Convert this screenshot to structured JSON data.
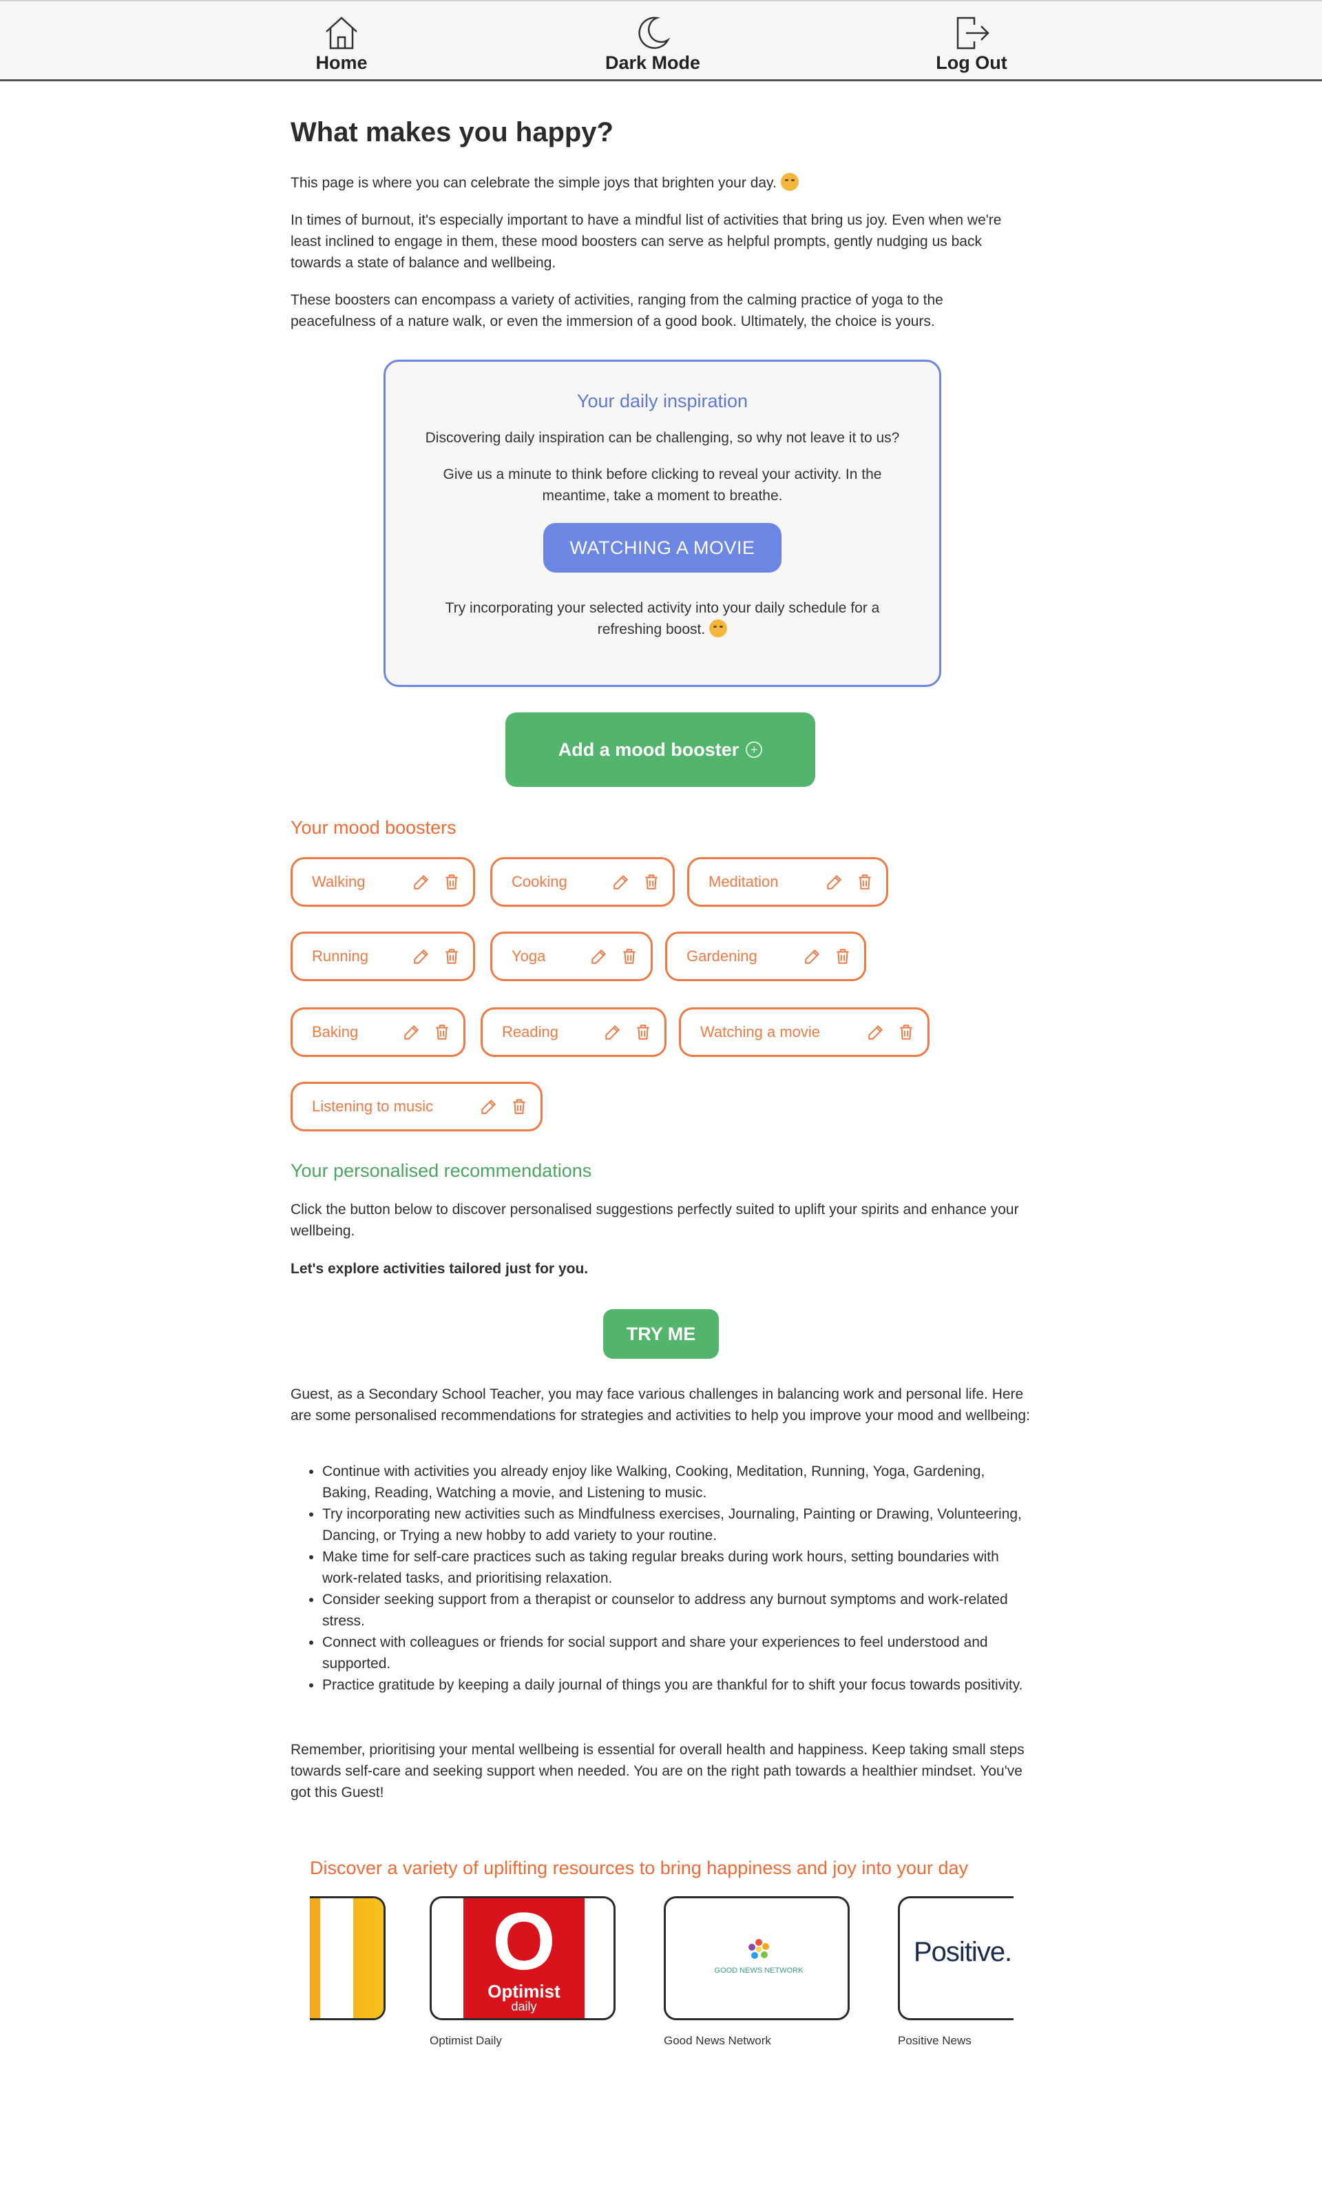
{
  "nav": {
    "home": "Home",
    "dark_mode": "Dark Mode",
    "log_out": "Log Out"
  },
  "page": {
    "title": "What makes you happy?",
    "intro1": "This page is where you can celebrate the simple joys that brighten your day.",
    "intro2": "In times of burnout, it's especially important to have a mindful list of activities that bring us joy. Even when we're least inclined to engage in them, these mood boosters can serve as helpful prompts, gently nudging us back towards a state of balance and wellbeing.",
    "intro3": "These boosters can encompass a variety of activities, ranging from the calming practice of yoga to the peacefulness of a nature walk, or even the immersion of a good book. Ultimately, the choice is yours."
  },
  "inspiration": {
    "title": "Your daily inspiration",
    "text1": "Discovering daily inspiration can be challenging, so why not leave it to us?",
    "text2": "Give us a minute to think before clicking to reveal your activity. In the meantime, take a moment to breathe.",
    "button": "WATCHING A MOVIE",
    "text3": "Try incorporating your selected activity into your daily schedule for a refreshing boost."
  },
  "add_booster": {
    "label": "Add a mood booster",
    "icon": "plus-circle-icon"
  },
  "mood_boosters": {
    "title": "Your mood boosters",
    "items": [
      "Walking",
      "Cooking",
      "Meditation",
      "Running",
      "Yoga",
      "Gardening",
      "Baking",
      "Reading",
      "Watching a movie",
      "Listening to music"
    ]
  },
  "recommendations": {
    "title": "Your personalised recommendations",
    "text1": "Click the button below to discover personalised suggestions perfectly suited to uplift your spirits and enhance your wellbeing.",
    "text2": "Let's explore activities tailored just for you.",
    "button": "TRY ME",
    "result_intro": "Guest, as a Secondary School Teacher, you may face various challenges in balancing work and personal life. Here are some personalised recommendations for strategies and activities to help you improve your mood and wellbeing:",
    "items": [
      "Continue with activities you already enjoy like Walking, Cooking, Meditation, Running, Yoga, Gardening, Baking, Reading, Watching a movie, and Listening to music.",
      "Try incorporating new activities such as Mindfulness exercises, Journaling, Painting or Drawing, Volunteering, Dancing, or Trying a new hobby to add variety to your routine.",
      "Make time for self-care practices such as taking regular breaks during work hours, setting boundaries with work-related tasks, and prioritising relaxation.",
      "Consider seeking support from a therapist or counselor to address any burnout symptoms and work-related stress.",
      "Connect with colleagues or friends for social support and share your experiences to feel understood and supported.",
      "Practice gratitude by keeping a daily journal of things you are thankful for to shift your focus towards positivity."
    ],
    "outro": "Remember, prioritising your mental wellbeing is essential for overall health and happiness. Keep taking small steps towards self-care and seeking support when needed. You are on the right path towards a healthier mindset. You've got this Guest!"
  },
  "resources": {
    "title": "Discover a variety of uplifting resources to bring happiness and joy into your day",
    "cards": [
      {
        "label": "Optimist Daily",
        "logo_main": "O",
        "logo_sub": "Optimist",
        "logo_sub2": "daily"
      },
      {
        "label": "Good News Network",
        "logo_text": "GOOD NEWS NETWORK"
      },
      {
        "label": "Positive News",
        "logo_text": "Positive.N"
      }
    ]
  },
  "colors": {
    "accent_blue": "#6c87e3",
    "accent_green": "#52b56b",
    "accent_orange": "#ef7a45"
  }
}
